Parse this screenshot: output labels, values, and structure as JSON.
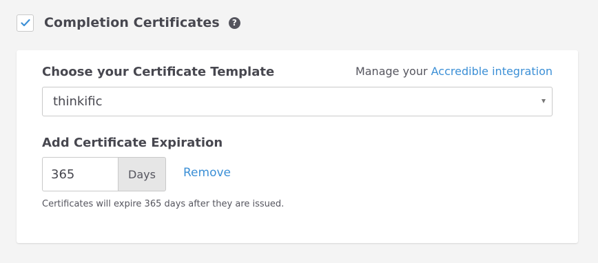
{
  "header": {
    "checked": true,
    "title": "Completion Certificates",
    "help_glyph": "?"
  },
  "template": {
    "label": "Choose your Certificate Template",
    "manage_prefix": "Manage your ",
    "manage_link": "Accredible integration",
    "selected": "thinkific"
  },
  "expiration": {
    "label": "Add Certificate Expiration",
    "value": "365",
    "unit": "Days",
    "remove_label": "Remove",
    "help_text": "Certificates will expire 365 days after they are issued."
  },
  "colors": {
    "accent": "#3b8fd6",
    "text": "#47474f",
    "background": "#f4f4f4"
  }
}
